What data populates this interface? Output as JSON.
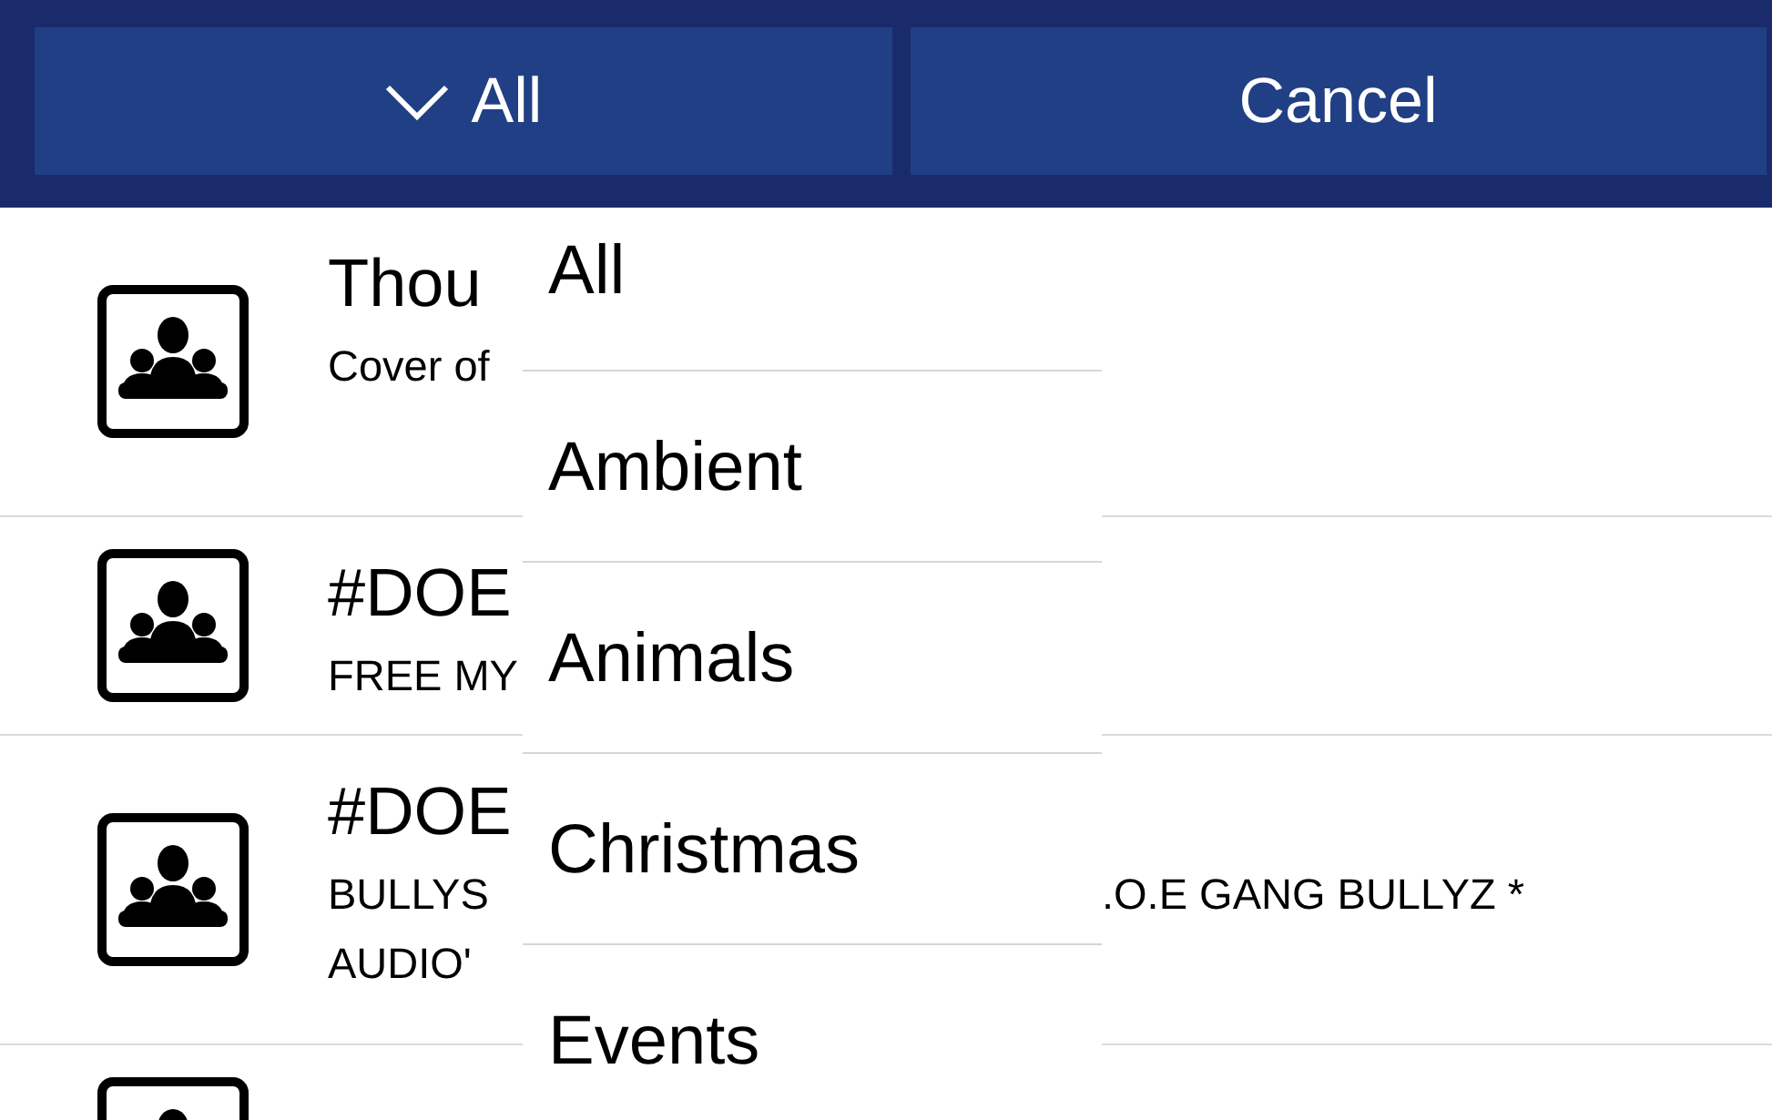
{
  "header": {
    "filter_button": {
      "label": "All"
    },
    "cancel_button": {
      "label": "Cancel"
    }
  },
  "tracks": [
    {
      "kind": "track",
      "title": "Thou",
      "subtitle_lines": [
        {
          "left": "Cover of"
        }
      ]
    },
    {
      "kind": "track",
      "title": "#DOE",
      "subtitle_lines": [
        {
          "left": "FREE MY"
        }
      ]
    },
    {
      "kind": "track",
      "title": "#DOE",
      "subtitle_lines": [
        {
          "left": "BULLYS",
          "right": ".O.E GANG BULLYZ *"
        },
        {
          "left": "AUDIO'"
        }
      ]
    },
    {
      "kind": "track"
    }
  ],
  "category_menu": {
    "items": [
      {
        "label": "All"
      },
      {
        "label": "Ambient"
      },
      {
        "label": "Animals"
      },
      {
        "label": "Christmas"
      },
      {
        "label": "Events"
      }
    ]
  }
}
